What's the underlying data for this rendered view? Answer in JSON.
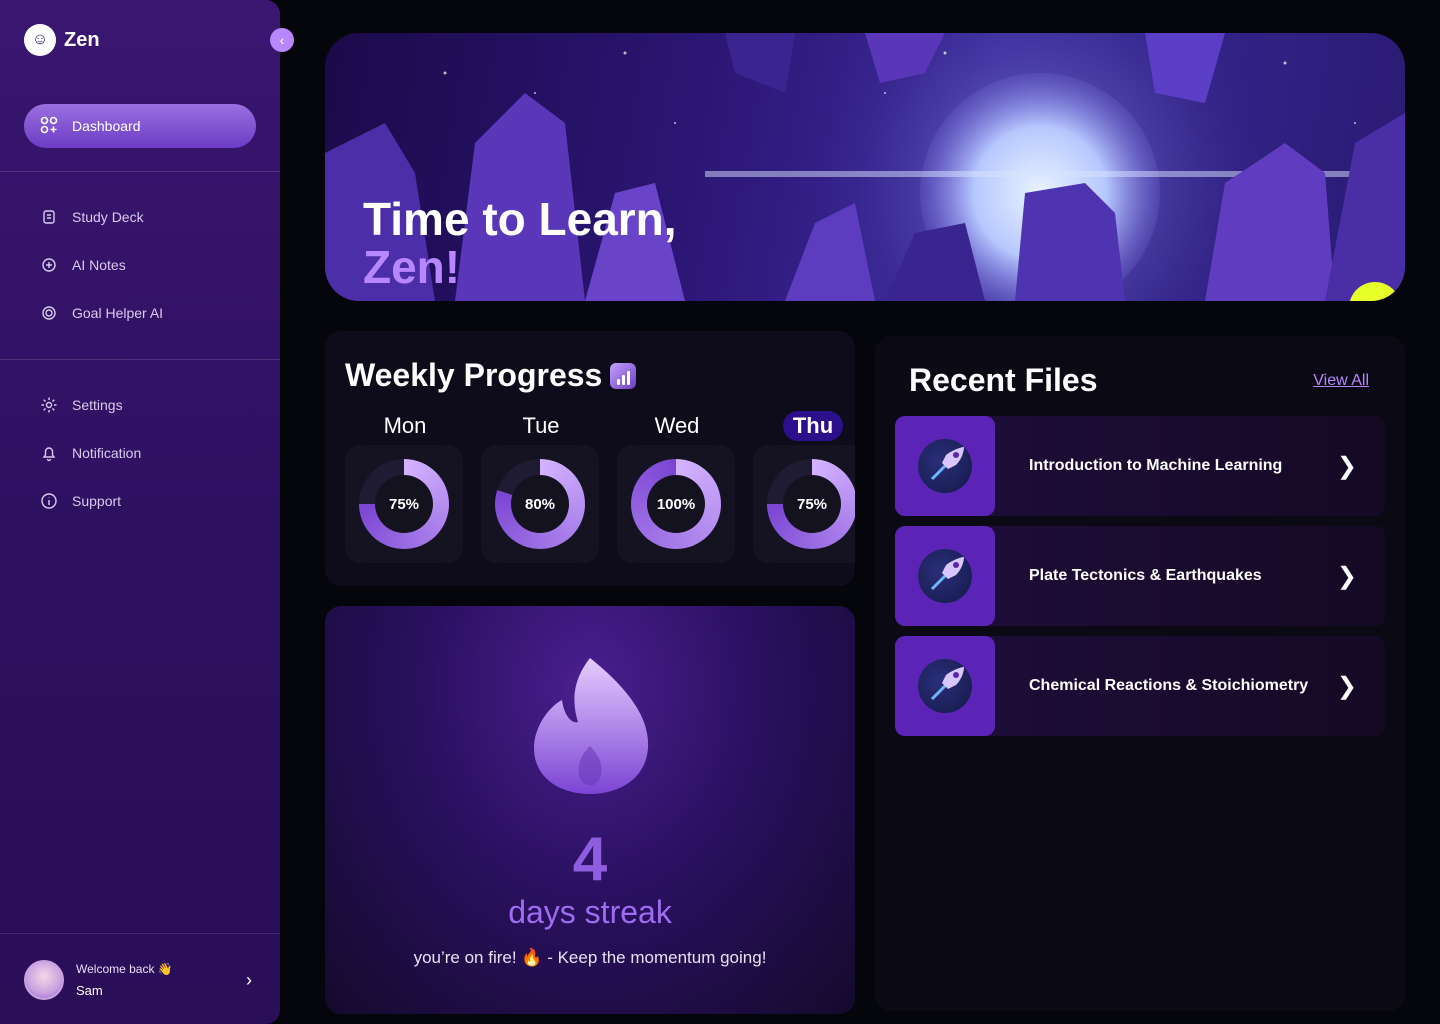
{
  "app": {
    "name": "Zen"
  },
  "sidebar": {
    "collapse_icon": "chevron-left-icon",
    "primary": {
      "label": "Dashboard",
      "icon": "grid-icon"
    },
    "group1": [
      {
        "label": "Study Deck",
        "icon": "deck-icon"
      },
      {
        "label": "AI Notes",
        "icon": "notes-icon"
      },
      {
        "label": "Goal Helper AI",
        "icon": "target-icon"
      }
    ],
    "group2": [
      {
        "label": "Settings",
        "icon": "gear-icon"
      },
      {
        "label": "Notification",
        "icon": "bell-icon"
      },
      {
        "label": "Support",
        "icon": "info-icon"
      }
    ],
    "user": {
      "greeting": "Welcome back 👋",
      "name": "Sam"
    }
  },
  "hero": {
    "title_line1": "Time to Learn,",
    "title_line2": "Zen!"
  },
  "weekly_progress": {
    "title": "Weekly Progress",
    "days": [
      {
        "label": "Mon",
        "percent": 75,
        "display": "75%"
      },
      {
        "label": "Tue",
        "percent": 80,
        "display": "80%"
      },
      {
        "label": "Wed",
        "percent": 100,
        "display": "100%"
      },
      {
        "label": "Thu",
        "percent": 75,
        "display": "75%",
        "active": true
      }
    ]
  },
  "streak": {
    "count": "4",
    "label": "days streak",
    "message": "you’re on fire! 🔥 - Keep the momentum going!"
  },
  "recent_files": {
    "title": "Recent Files",
    "view_all": "View All",
    "items": [
      {
        "name": "Introduction to Machine Learning"
      },
      {
        "name": "Plate Tectonics & Earthquakes"
      },
      {
        "name": "Chemical Reactions & Stoichiometry"
      }
    ]
  },
  "colors": {
    "accent": "#b886ff",
    "sidebar": "#2c0f5e",
    "background": "#05050c"
  }
}
